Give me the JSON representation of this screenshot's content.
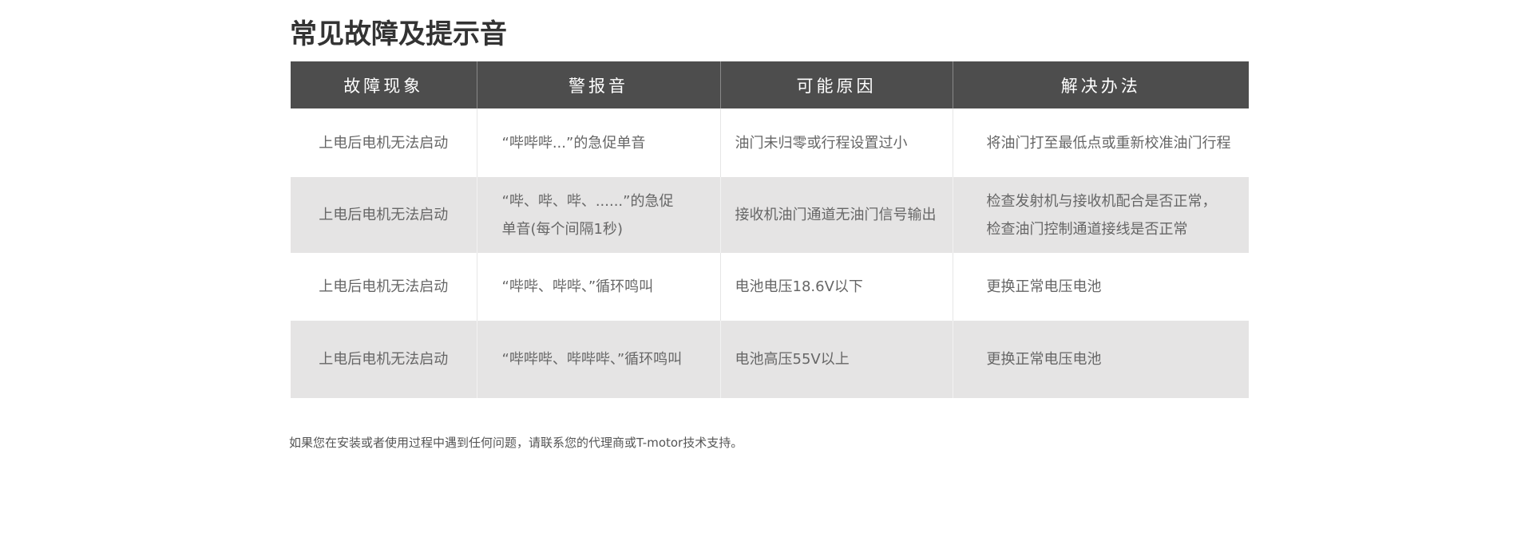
{
  "page": {
    "title": "常见故障及提示音",
    "footer_note": "如果您在安装或者使用过程中遇到任何问题，请联系您的代理商或T-motor技术支持。"
  },
  "table": {
    "headers": [
      "故障现象",
      "警报音",
      "可能原因",
      "解决办法"
    ],
    "rows": [
      {
        "symptom": "上电后电机无法启动",
        "alarm": "“哔哔哔...”的急促单音",
        "cause": "油门未归零或行程设置过小",
        "solution": "将油门打至最低点或重新校准油门行程"
      },
      {
        "symptom": "上电后电机无法启动",
        "alarm": "“哔、哔、哔、......”的急促\n单音(每个间隔1秒)",
        "cause": "接收机油门通道无油门信号输出",
        "solution": "检查发射机与接收机配合是否正常，\n检查油门控制通道接线是否正常"
      },
      {
        "symptom": "上电后电机无法启动",
        "alarm": "“哔哔、哔哔、”循环鸣叫",
        "cause": "电池电压18.6V以下",
        "solution": "更换正常电压电池"
      },
      {
        "symptom": "上电后电机无法启动",
        "alarm": "“哔哔哔、哔哔哔、”循环鸣叫",
        "cause": "电池高压55V以上",
        "solution": "更换正常电压电池"
      }
    ]
  },
  "colors": {
    "header_bg": "#4d4d4d",
    "stripe_bg": "#e5e4e4",
    "text": "#666666",
    "title": "#333333"
  }
}
